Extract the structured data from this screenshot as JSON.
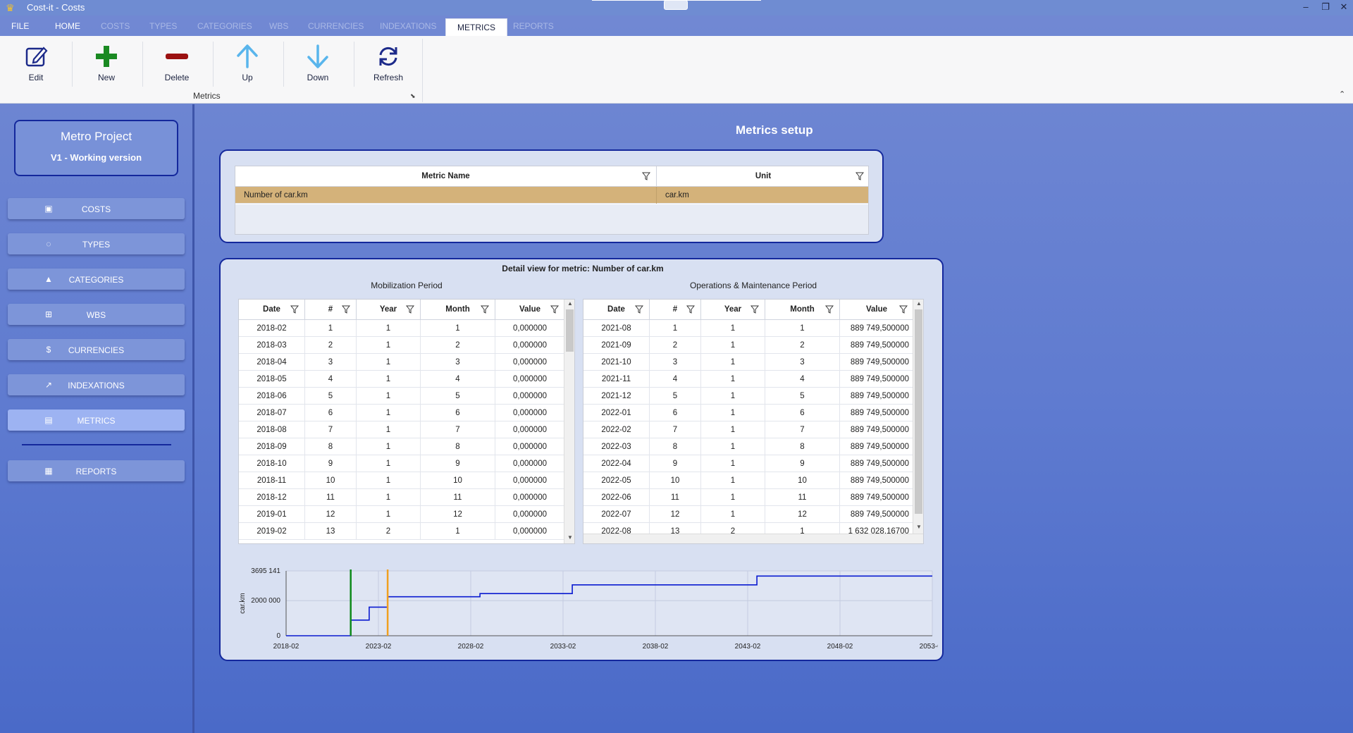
{
  "window": {
    "title": "Cost-it - Costs"
  },
  "menu": {
    "tabs": [
      "FILE",
      "HOME",
      "COSTS",
      "TYPES",
      "CATEGORIES",
      "WBS",
      "CURRENCIES",
      "INDEXATIONS",
      "METRICS",
      "REPORTS"
    ],
    "active": "METRICS"
  },
  "ribbon": {
    "buttons": {
      "edit": "Edit",
      "new": "New",
      "delete": "Delete",
      "up": "Up",
      "down": "Down",
      "refresh": "Refresh"
    },
    "group_label": "Metrics",
    "colors": {
      "new": "#1a8a22",
      "delete": "#9b1111",
      "arrows": "#59b5ec",
      "edit": "#1c2a8a"
    }
  },
  "sidebar": {
    "project_name": "Metro Project",
    "version": "V1 - Working version",
    "items": [
      {
        "label": "COSTS",
        "icon": "money-icon"
      },
      {
        "label": "TYPES",
        "icon": "circle-icon"
      },
      {
        "label": "CATEGORIES",
        "icon": "shapes-icon"
      },
      {
        "label": "WBS",
        "icon": "hierarchy-icon"
      },
      {
        "label": "CURRENCIES",
        "icon": "dollar-icon"
      },
      {
        "label": "INDEXATIONS",
        "icon": "trend-icon"
      },
      {
        "label": "METRICS",
        "icon": "calculator-icon",
        "active": true
      },
      {
        "label": "REPORTS",
        "icon": "dashboard-icon"
      }
    ]
  },
  "main": {
    "title": "Metrics setup",
    "metrics_table": {
      "columns": [
        "Metric Name",
        "Unit"
      ],
      "rows": [
        {
          "name": "Number of car.km",
          "unit": "car.km",
          "selected": true
        }
      ],
      "selected_color": "#d4b27a"
    },
    "detail": {
      "title": "Detail view for metric: Number of car.km",
      "mobilization": {
        "caption": "Mobilization Period",
        "columns": [
          "Date",
          "#",
          "Year",
          "Month",
          "Value"
        ],
        "rows": [
          [
            "2018-02",
            "1",
            "1",
            "1",
            "0,000000"
          ],
          [
            "2018-03",
            "2",
            "1",
            "2",
            "0,000000"
          ],
          [
            "2018-04",
            "3",
            "1",
            "3",
            "0,000000"
          ],
          [
            "2018-05",
            "4",
            "1",
            "4",
            "0,000000"
          ],
          [
            "2018-06",
            "5",
            "1",
            "5",
            "0,000000"
          ],
          [
            "2018-07",
            "6",
            "1",
            "6",
            "0,000000"
          ],
          [
            "2018-08",
            "7",
            "1",
            "7",
            "0,000000"
          ],
          [
            "2018-09",
            "8",
            "1",
            "8",
            "0,000000"
          ],
          [
            "2018-10",
            "9",
            "1",
            "9",
            "0,000000"
          ],
          [
            "2018-11",
            "10",
            "1",
            "10",
            "0,000000"
          ],
          [
            "2018-12",
            "11",
            "1",
            "11",
            "0,000000"
          ],
          [
            "2019-01",
            "12",
            "1",
            "12",
            "0,000000"
          ],
          [
            "2019-02",
            "13",
            "2",
            "1",
            "0,000000"
          ]
        ]
      },
      "operations": {
        "caption": "Operations & Maintenance Period",
        "columns": [
          "Date",
          "#",
          "Year",
          "Month",
          "Value"
        ],
        "rows": [
          [
            "2021-08",
            "1",
            "1",
            "1",
            "889 749,500000"
          ],
          [
            "2021-09",
            "2",
            "1",
            "2",
            "889 749,500000"
          ],
          [
            "2021-10",
            "3",
            "1",
            "3",
            "889 749,500000"
          ],
          [
            "2021-11",
            "4",
            "1",
            "4",
            "889 749,500000"
          ],
          [
            "2021-12",
            "5",
            "1",
            "5",
            "889 749,500000"
          ],
          [
            "2022-01",
            "6",
            "1",
            "6",
            "889 749,500000"
          ],
          [
            "2022-02",
            "7",
            "1",
            "7",
            "889 749,500000"
          ],
          [
            "2022-03",
            "8",
            "1",
            "8",
            "889 749,500000"
          ],
          [
            "2022-04",
            "9",
            "1",
            "9",
            "889 749,500000"
          ],
          [
            "2022-05",
            "10",
            "1",
            "10",
            "889 749,500000"
          ],
          [
            "2022-06",
            "11",
            "1",
            "11",
            "889 749,500000"
          ],
          [
            "2022-07",
            "12",
            "1",
            "12",
            "889 749,500000"
          ],
          [
            "2022-08",
            "13",
            "2",
            "1",
            "1 632 028,16700"
          ]
        ]
      }
    }
  },
  "chart_data": {
    "type": "line",
    "ylabel": "car.km",
    "xlabel": "",
    "ylim": [
      0,
      3695141
    ],
    "yticks": [
      {
        "value": 0,
        "label": "0"
      },
      {
        "value": 2000000,
        "label": "2000 000"
      },
      {
        "value": 3695141,
        "label": "3695 141"
      }
    ],
    "xticks": [
      "2018-02",
      "2023-02",
      "2028-02",
      "2033-02",
      "2038-02",
      "2043-02",
      "2048-02",
      "2053-02"
    ],
    "xlim": [
      "2018-02",
      "2053-02"
    ],
    "grid": true,
    "series": [
      {
        "color": "#0a1bd0",
        "points": [
          [
            "2018-02",
            0
          ],
          [
            "2021-08",
            0
          ],
          [
            "2021-08",
            889749.5
          ],
          [
            "2022-08",
            889749.5
          ],
          [
            "2022-08",
            1632028.167
          ],
          [
            "2023-08",
            1632028.167
          ],
          [
            "2023-08",
            2220000
          ],
          [
            "2028-08",
            2220000
          ],
          [
            "2028-08",
            2400000
          ],
          [
            "2033-08",
            2400000
          ],
          [
            "2033-08",
            2900000
          ],
          [
            "2043-08",
            2900000
          ],
          [
            "2043-08",
            3400000
          ],
          [
            "2053-02",
            3400000
          ]
        ]
      }
    ],
    "markers": [
      {
        "x": "2021-08",
        "color": "#0e8a1a"
      },
      {
        "x": "2023-08",
        "color": "#f0a020"
      }
    ]
  }
}
